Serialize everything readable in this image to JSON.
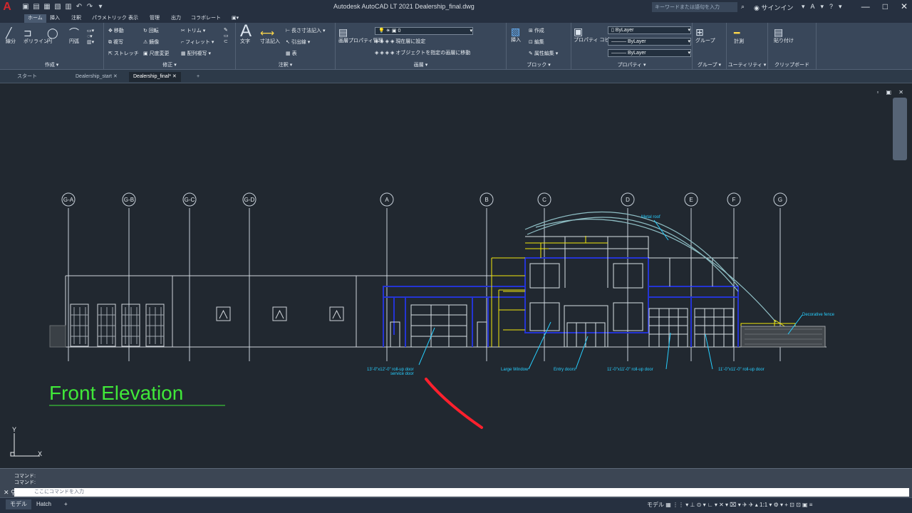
{
  "app": {
    "title": "Autodesk AutoCAD LT 2021   Dealership_final.dwg",
    "logo": "A",
    "search_placeholder": "キーワードまたは語句を入力",
    "user": "サインイン"
  },
  "menu_tabs": [
    {
      "label": "ホーム"
    },
    {
      "label": "挿入"
    },
    {
      "label": "注釈"
    },
    {
      "label": "パラメトリック"
    },
    {
      "label": "表示"
    },
    {
      "label": "管理"
    },
    {
      "label": "出力"
    },
    {
      "label": "コラボレート"
    },
    {
      "label": "▣▾"
    }
  ],
  "ribbon": {
    "panels": [
      {
        "title": "作成 ▾",
        "tools": [
          "線分",
          "ポリライン",
          "円",
          "円弧"
        ]
      },
      {
        "title": "修正 ▾",
        "tools": [
          "移動",
          "回転",
          "トリム",
          "複写",
          "鏡像",
          "フィレット",
          "ストレッチ",
          "尺度変更",
          "配列複写"
        ]
      },
      {
        "title": "注釈 ▾",
        "tools": [
          "文字",
          "寸法記入",
          "長さ寸法記入",
          "引出線",
          "表"
        ]
      },
      {
        "title": "画層 ▾",
        "tools": [
          "画層プロパティ管理",
          "0",
          "現在層に設定",
          "オブジェクトを指定の画層に移動"
        ]
      },
      {
        "title": "ブロック ▾",
        "tools": [
          "挿入",
          "作成",
          "編集",
          "属性編集"
        ]
      },
      {
        "title": "プロパティ ▾",
        "tools": [
          "プロパティ コピー",
          "ByLayer",
          "ByLayer",
          "ByLayer"
        ]
      },
      {
        "title": "グループ ▾",
        "tools": [
          "グループ"
        ]
      },
      {
        "title": "ユーティリティ ▾",
        "tools": [
          "計測"
        ]
      },
      {
        "title": "クリップボード",
        "tools": [
          "貼り付け"
        ]
      }
    ]
  },
  "documents": [
    {
      "label": "スタート"
    },
    {
      "label": "Dealership_start  ✕"
    },
    {
      "label": "Dealership_final*  ✕"
    },
    {
      "label": "+"
    }
  ],
  "drawing": {
    "title": "Front Elevation",
    "grids": [
      "G-A",
      "G-B",
      "G-C",
      "G-D",
      "A",
      "B",
      "C",
      "D",
      "E",
      "F",
      "G"
    ],
    "annotations": [
      "Metal roof",
      "Decorative fence",
      "13'-0\"x12'-0\" roll-up door",
      "service door",
      "Large Window",
      "Entry doors",
      "11'-0\"x11'-0\" roll-up door",
      "11'-0\"x11'-0\" roll-up door"
    ],
    "ucs_x": "X",
    "ucs_y": "Y"
  },
  "command": {
    "history": [
      "コマンド:",
      "コマンド:"
    ],
    "placeholder": "ここにコマンドを入力"
  },
  "status": {
    "model": "モデル",
    "layout": "Hatch",
    "plus": "+",
    "right": "モデル ▦ ⋮⋮ ▾ ⊥ ⊙ ▾ ∟ ▾ ✕ ▾ ⌧ ▾ ✈ ✈ ▴ 1:1 ▾ ⚙ ▾ + ⊡ ⊡ ▣ ≡"
  },
  "colors": {
    "background": "#212830",
    "ribbon": "#39475a",
    "cyan": "#2dd8ff",
    "blue": "#1522b8",
    "yellow": "#f3e70c",
    "green": "#40e839",
    "red": "#ff202d"
  }
}
